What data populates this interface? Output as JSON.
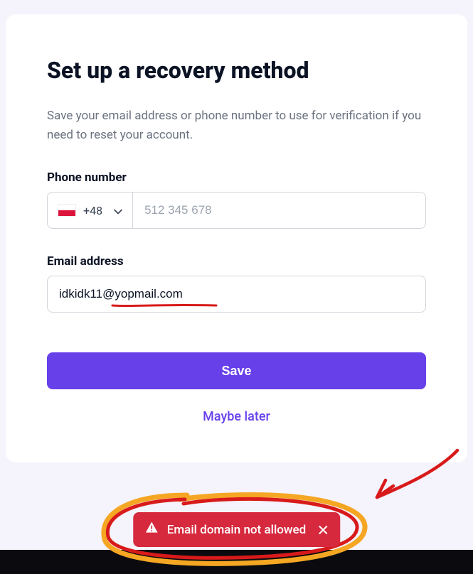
{
  "header": {
    "title": "Set up a recovery method",
    "subtitle": "Save your email address or phone number to use for verification if you need to reset your account."
  },
  "phone": {
    "label": "Phone number",
    "dial_code": "+48",
    "placeholder": "512 345 678",
    "value": ""
  },
  "email": {
    "label": "Email address",
    "value": "idkidk11@yopmail.com"
  },
  "actions": {
    "save_label": "Save",
    "later_label": "Maybe later"
  },
  "toast": {
    "message": "Email domain not allowed"
  },
  "colors": {
    "accent": "#6740ea",
    "error": "#d6293e",
    "annotation_red": "#d81a1a",
    "annotation_orange": "#f5a623"
  }
}
